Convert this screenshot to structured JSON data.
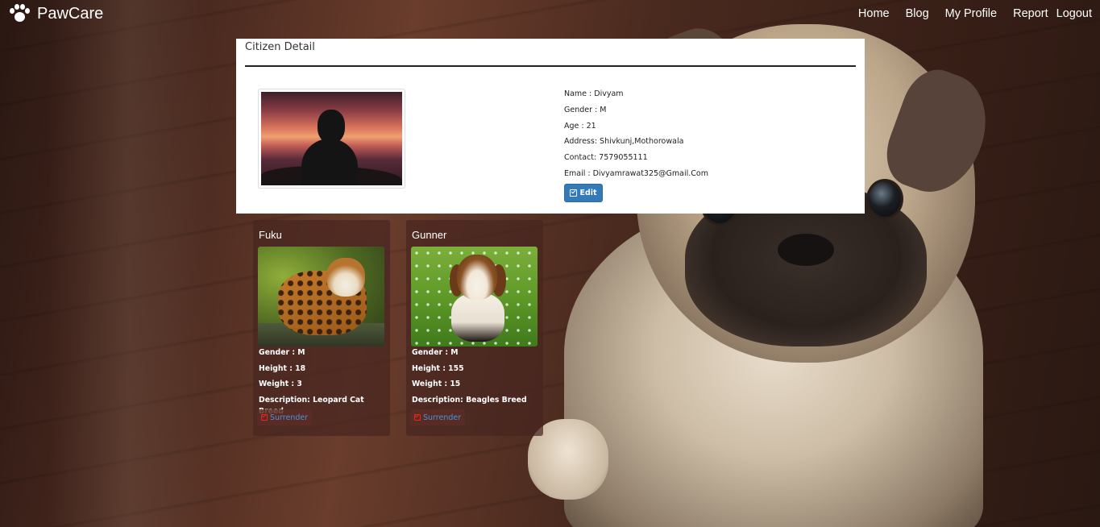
{
  "app": {
    "brand": "PawCare",
    "nav": [
      {
        "label": "Home"
      },
      {
        "label": "Blog"
      },
      {
        "label": "My Profile"
      },
      {
        "label": "Report"
      },
      {
        "label": "Logout"
      }
    ]
  },
  "citizen": {
    "panel_title": "Citizen Detail",
    "rows": [
      "Name : Divyam",
      "Gender : M",
      "Age : 21",
      "Address: Shivkunj,Mothorowala",
      "Contact: 7579055111",
      "Email : Divyamrawat325@Gmail.Com"
    ],
    "edit_label": "Edit"
  },
  "pets": [
    {
      "name": "Fuku",
      "rows": [
        "Gender : M",
        "Height : 18",
        "Weight : 3",
        "Description: Leopard Cat Breed"
      ],
      "action_label": "Surrender"
    },
    {
      "name": "Gunner",
      "rows": [
        "Gender : M",
        "Height : 155",
        "Weight : 15",
        "Description: Beagles Breed"
      ],
      "action_label": "Surrender"
    }
  ],
  "colors": {
    "primary_button": "#337ab7",
    "surrender_link": "#4a90d9",
    "surrender_icon": "#e8261c"
  },
  "icons": {
    "brand": "paw-icon",
    "edit": "edit-icon",
    "surrender": "surrender-icon"
  }
}
